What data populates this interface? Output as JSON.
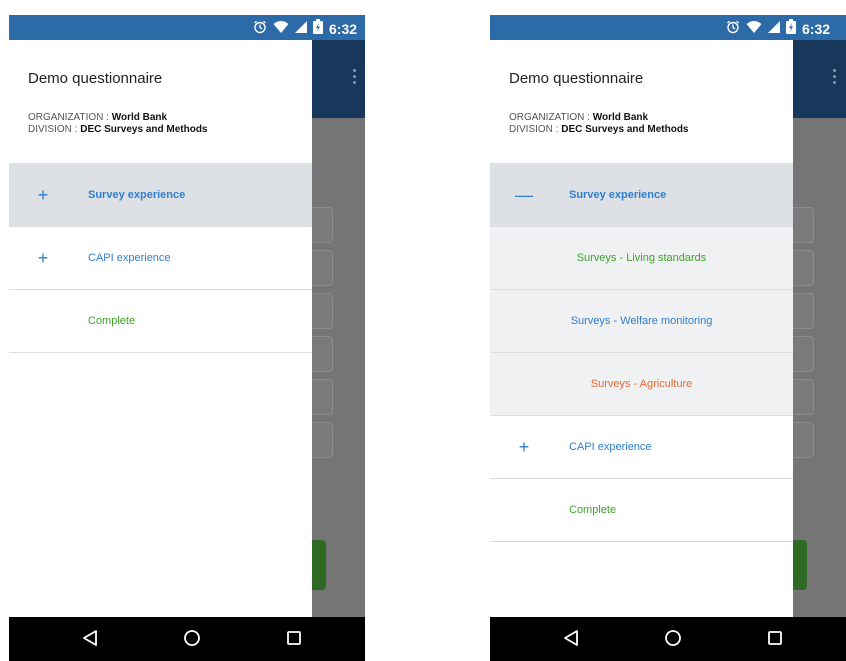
{
  "screens": [
    {
      "status": {
        "time": "6:32"
      },
      "drawer": {
        "title": "Demo questionnaire",
        "org_label": "ORGANIZATION : ",
        "org_value": "World Bank",
        "div_label": "DIVISION : ",
        "div_value": "DEC Surveys and Methods",
        "items": [
          {
            "control": "+",
            "label": "Survey experience",
            "state": "collapsed"
          },
          {
            "control": "+",
            "label": "CAPI experience",
            "state": "collapsed"
          },
          {
            "control": "",
            "label": "Complete",
            "state": "leaf"
          }
        ]
      }
    },
    {
      "status": {
        "time": "6:32"
      },
      "drawer": {
        "title": "Demo questionnaire",
        "org_label": "ORGANIZATION : ",
        "org_value": "World Bank",
        "div_label": "DIVISION : ",
        "div_value": "DEC Surveys and Methods",
        "items": [
          {
            "control": "—",
            "label": "Survey experience",
            "state": "expanded"
          },
          {
            "control": "",
            "label": "Surveys - Living standards",
            "state": "child",
            "status_color": "#3ea22a"
          },
          {
            "control": "",
            "label": "Surveys - Welfare monitoring",
            "state": "child",
            "status_color": "#2f7ecb"
          },
          {
            "control": "",
            "label": "Surveys - Agriculture",
            "state": "child",
            "status_color": "#e86a35"
          },
          {
            "control": "+",
            "label": "CAPI experience",
            "state": "collapsed"
          },
          {
            "control": "",
            "label": "Complete",
            "state": "leaf"
          }
        ]
      }
    }
  ],
  "icons": {
    "alarm": "alarm-icon",
    "wifi": "wifi-icon",
    "signal": "signal-icon",
    "battery": "battery-icon",
    "back": "back-icon",
    "home": "home-icon",
    "recents": "recents-icon",
    "overflow": "more-vert-icon"
  },
  "colors": {
    "status_bar": "#2c6aa8",
    "app_bar": "#17385a",
    "accent_blue": "#2f7ecb",
    "complete_green": "#3ea22a",
    "error_orange": "#e86a35",
    "active_row": "#dde1e6"
  }
}
